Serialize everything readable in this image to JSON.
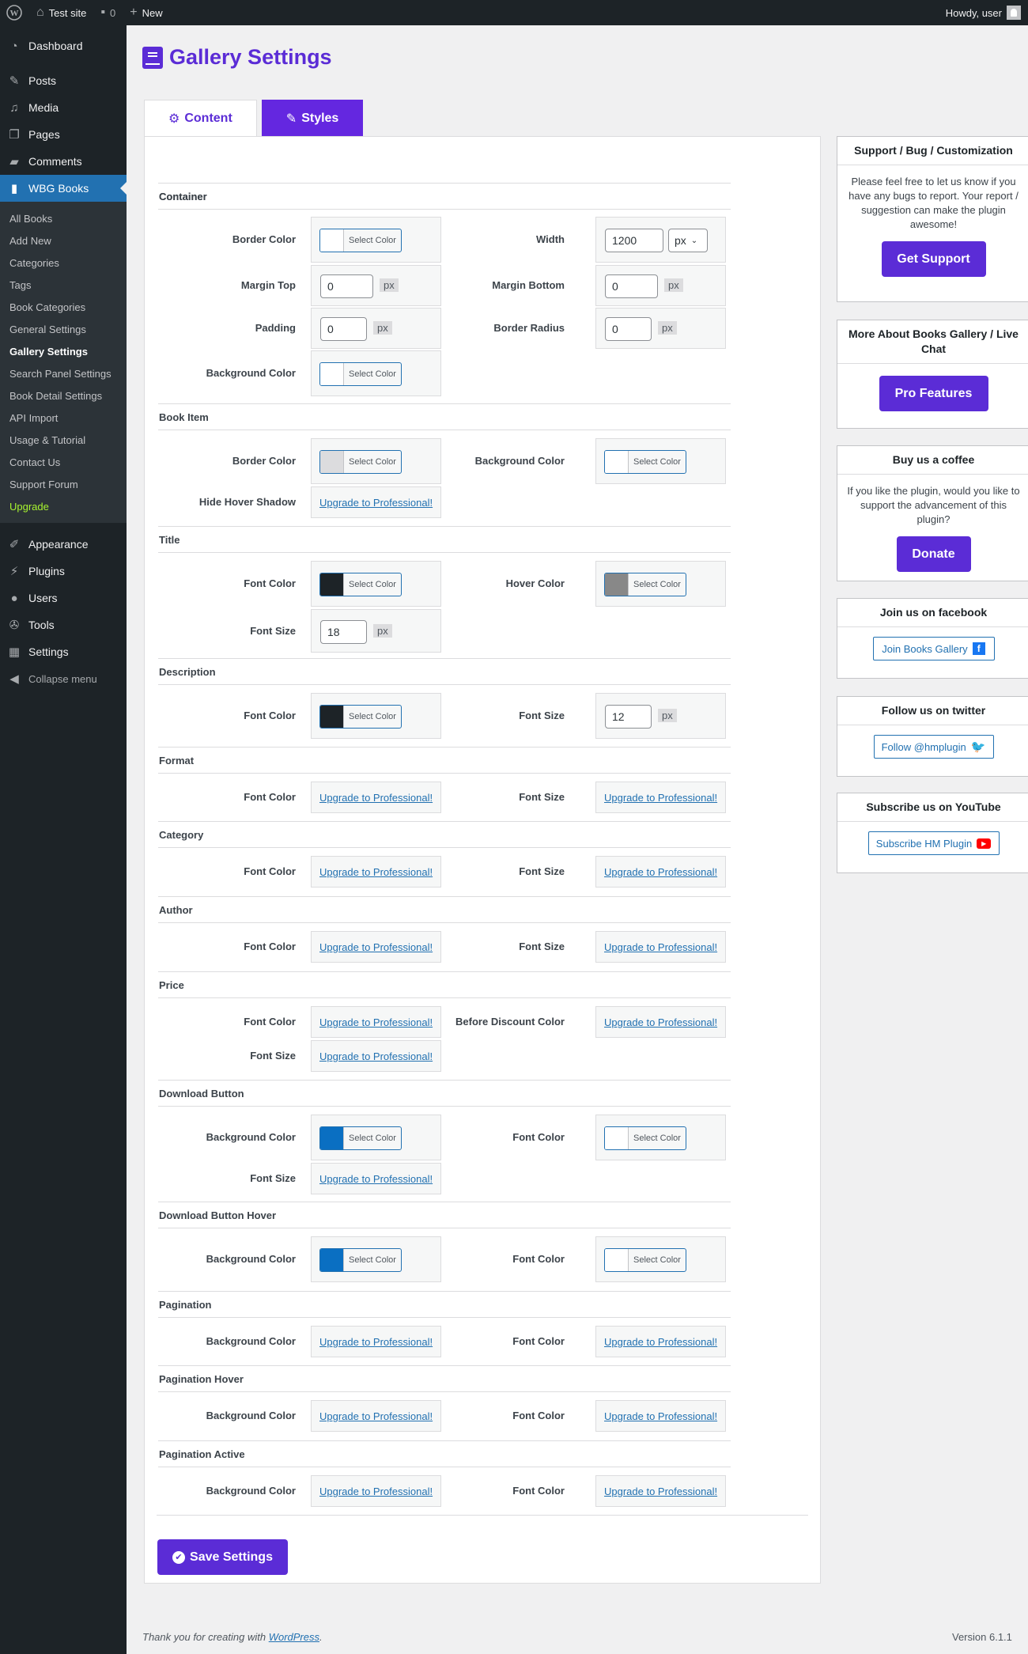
{
  "adminbar": {
    "site_name": "Test site",
    "comments_count": "0",
    "new_label": "New",
    "greeting": "Howdy, user"
  },
  "sidebar": {
    "items_top": [
      {
        "label": "Dashboard",
        "icon": "dashboard-icon"
      },
      {
        "label": "Posts",
        "icon": "pin-icon"
      },
      {
        "label": "Media",
        "icon": "media-icon"
      },
      {
        "label": "Pages",
        "icon": "pages-icon"
      },
      {
        "label": "Comments",
        "icon": "comment-icon"
      },
      {
        "label": "WBG Books",
        "icon": "book-icon"
      }
    ],
    "submenu": [
      "All Books",
      "Add New",
      "Categories",
      "Tags",
      "Book Categories",
      "General Settings",
      "Gallery Settings",
      "Search Panel Settings",
      "Book Detail Settings",
      "API Import",
      "Usage & Tutorial",
      "Contact Us",
      "Support Forum",
      "Upgrade"
    ],
    "items_bottom": [
      {
        "label": "Appearance",
        "icon": "brush-icon"
      },
      {
        "label": "Plugins",
        "icon": "plugin-icon"
      },
      {
        "label": "Users",
        "icon": "user-icon"
      },
      {
        "label": "Tools",
        "icon": "wrench-icon"
      },
      {
        "label": "Settings",
        "icon": "settings-icon"
      }
    ],
    "collapse": "Collapse menu"
  },
  "page": {
    "title": "Gallery Settings",
    "tabs": [
      "Content",
      "Styles"
    ],
    "select_color": "Select Color",
    "upgrade": "Upgrade to Professional!",
    "unit": "px",
    "save": "Save Settings"
  },
  "sections": {
    "container": {
      "title": "Container",
      "border_color": "Border Color",
      "width": "Width",
      "width_value": "1200",
      "width_unit": "px",
      "margin_top": "Margin Top",
      "margin_top_value": "0",
      "margin_bottom": "Margin Bottom",
      "margin_bottom_value": "0",
      "padding": "Padding",
      "padding_value": "0",
      "border_radius": "Border Radius",
      "border_radius_value": "0",
      "background_color": "Background Color"
    },
    "book_item": {
      "title": "Book Item",
      "border_color": "Border Color",
      "background_color": "Background Color",
      "hide_hover_shadow": "Hide Hover Shadow"
    },
    "title": {
      "title": "Title",
      "font_color": "Font Color",
      "hover_color": "Hover Color",
      "font_size": "Font Size",
      "font_size_value": "18"
    },
    "description": {
      "title": "Description",
      "font_color": "Font Color",
      "font_size": "Font Size",
      "font_size_value": "12"
    },
    "format": {
      "title": "Format",
      "font_color": "Font Color",
      "font_size": "Font Size"
    },
    "category": {
      "title": "Category",
      "font_color": "Font Color",
      "font_size": "Font Size"
    },
    "author": {
      "title": "Author",
      "font_color": "Font Color",
      "font_size": "Font Size"
    },
    "price": {
      "title": "Price",
      "font_color": "Font Color",
      "before_discount": "Before Discount Color",
      "font_size": "Font Size"
    },
    "download_button": {
      "title": "Download Button",
      "background_color": "Background Color",
      "font_color": "Font Color",
      "font_size": "Font Size"
    },
    "download_button_hover": {
      "title": "Download Button Hover",
      "background_color": "Background Color",
      "font_color": "Font Color"
    },
    "pagination": {
      "title": "Pagination",
      "background_color": "Background Color",
      "font_color": "Font Color"
    },
    "pagination_hover": {
      "title": "Pagination Hover",
      "background_color": "Background Color",
      "font_color": "Font Color"
    },
    "pagination_active": {
      "title": "Pagination Active",
      "background_color": "Background Color",
      "font_color": "Font Color"
    }
  },
  "widgets": {
    "support": {
      "title": "Support / Bug / Customization",
      "text": "Please feel free to let us know if you have any bugs to report. Your report / suggestion can make the plugin awesome!",
      "button": "Get Support"
    },
    "more": {
      "title": "More About Books Gallery / Live Chat",
      "button": "Pro Features"
    },
    "coffee": {
      "title": "Buy us a coffee",
      "text": "If you like the plugin, would you like to support the advancement of this plugin?",
      "button": "Donate"
    },
    "facebook": {
      "title": "Join us on facebook",
      "button": "Join Books Gallery"
    },
    "twitter": {
      "title": "Follow us on twitter",
      "button": "Follow @hmplugin"
    },
    "youtube": {
      "title": "Subscribe us on YouTube",
      "button": "Subscribe HM Plugin"
    }
  },
  "footer": {
    "text": "Thank you for creating with",
    "link": "WordPress",
    "version": "Version 6.1.1"
  },
  "colors": {
    "accent": "#5b2cd6",
    "wp_blue": "#2271b1",
    "swatch_dark": "#1d2327",
    "swatch_gray": "#888888",
    "swatch_light": "#dcdcde",
    "swatch_blue": "#0a6fc2"
  }
}
